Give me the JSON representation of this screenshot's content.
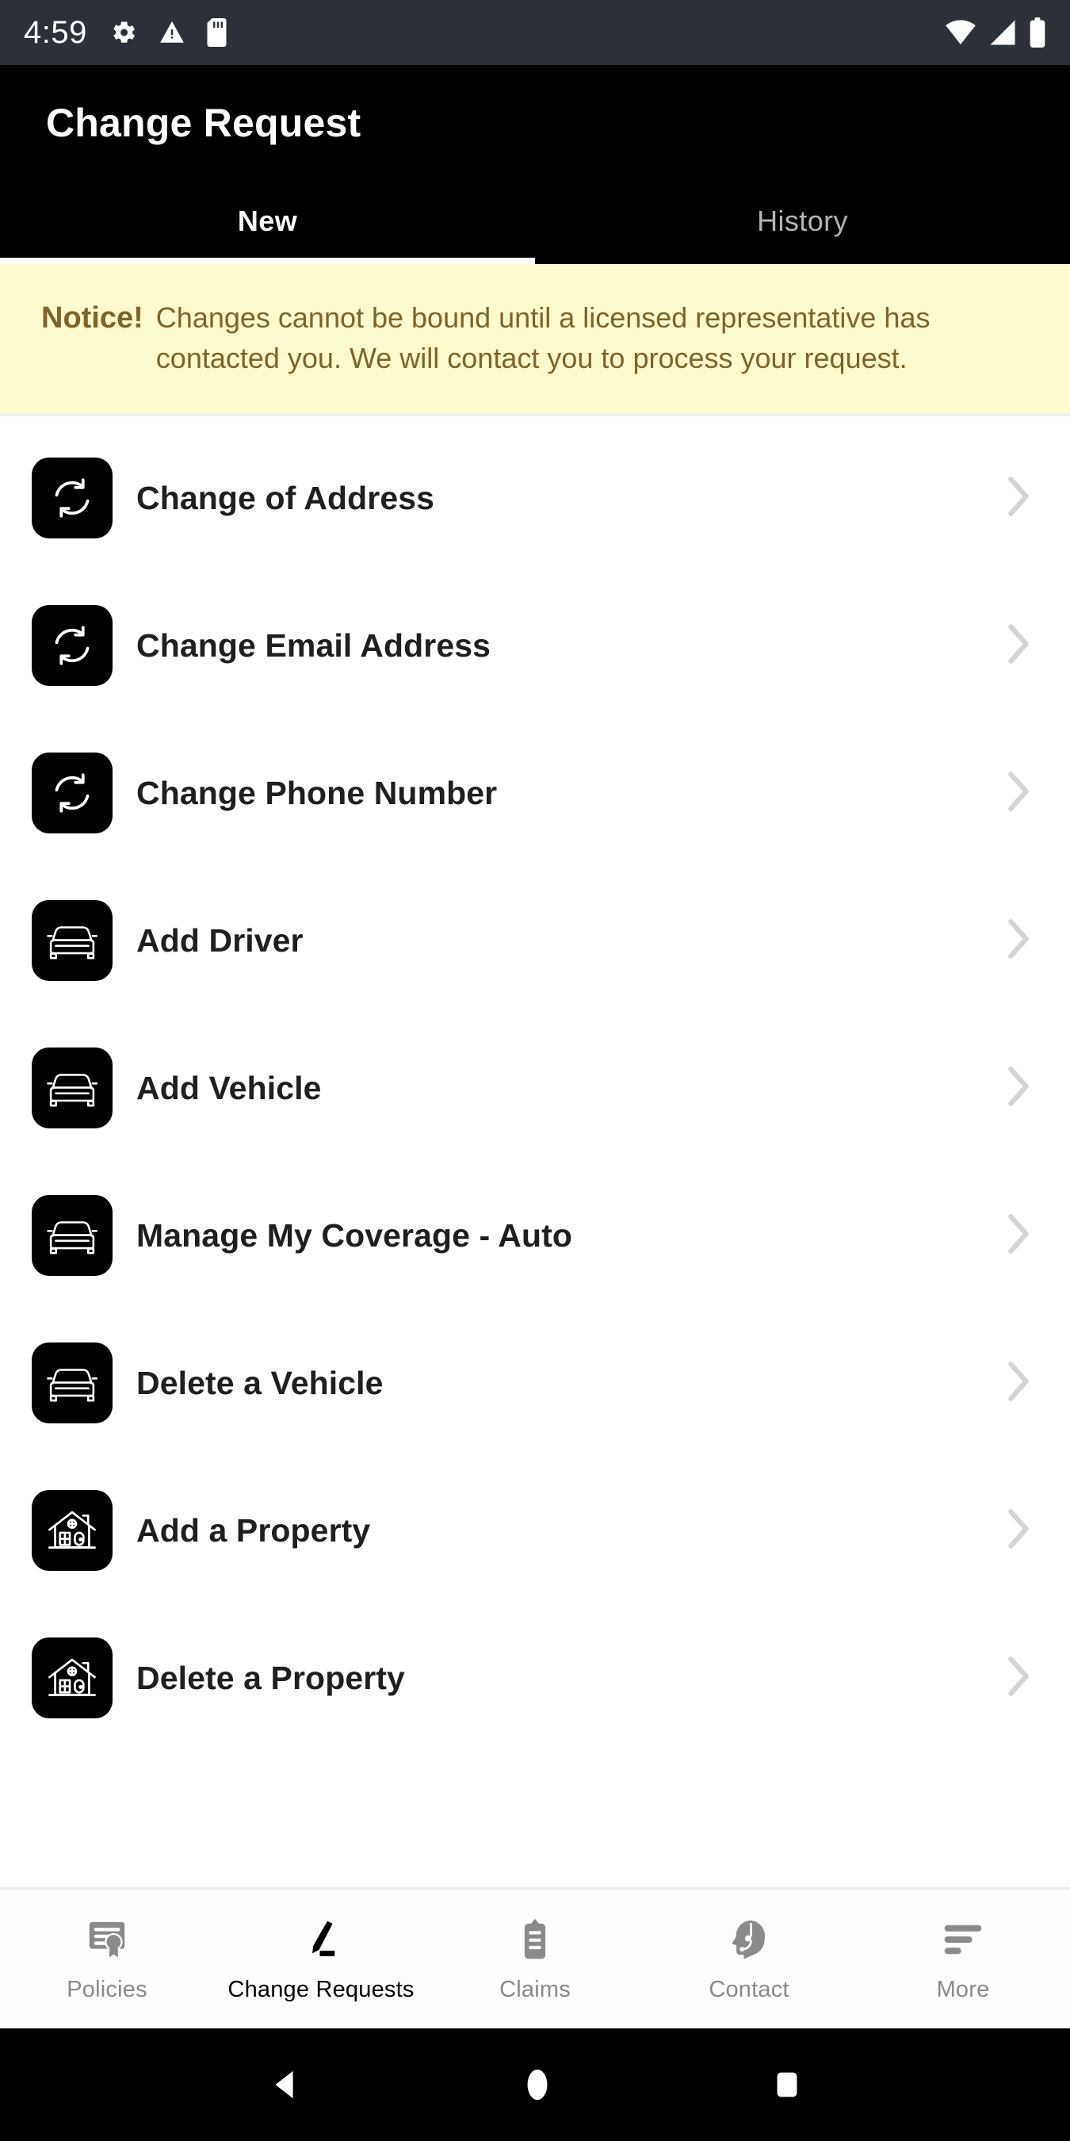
{
  "status_bar": {
    "time": "4:59",
    "left_icons": [
      "gear-icon",
      "warning-triangle-icon",
      "sd-card-icon"
    ],
    "right_icons": [
      "wifi-icon",
      "cellular-signal-icon",
      "battery-icon"
    ],
    "background_color": "#2c3038"
  },
  "app_bar": {
    "title": "Change Request",
    "background_color": "#000000"
  },
  "tabs": [
    {
      "label": "New",
      "active": true
    },
    {
      "label": "History",
      "active": false
    }
  ],
  "notice": {
    "label": "Notice!",
    "text": "Changes cannot be bound until a licensed representative has contacted you. We will contact you to process your request.",
    "background_color": "#fbfacc",
    "text_color": "#7d6428"
  },
  "list": {
    "items": [
      {
        "label": "Change of Address",
        "icon": "refresh-icon"
      },
      {
        "label": "Change Email Address",
        "icon": "refresh-icon"
      },
      {
        "label": "Change Phone Number",
        "icon": "refresh-icon"
      },
      {
        "label": "Add Driver",
        "icon": "car-icon"
      },
      {
        "label": "Add Vehicle",
        "icon": "car-icon"
      },
      {
        "label": "Manage My Coverage - Auto",
        "icon": "car-icon"
      },
      {
        "label": "Delete a Vehicle",
        "icon": "car-icon"
      },
      {
        "label": "Add a Property",
        "icon": "house-icon"
      },
      {
        "label": "Delete a Property",
        "icon": "house-icon"
      }
    ],
    "chevron_icon": "chevron-right-icon",
    "chevron_color": "#d4d4d4"
  },
  "bottom_nav": {
    "items": [
      {
        "label": "Policies",
        "icon": "certificate-icon",
        "active": false
      },
      {
        "label": "Change Requests",
        "icon": "pencil-icon",
        "active": true
      },
      {
        "label": "Claims",
        "icon": "clipboard-icon",
        "active": false
      },
      {
        "label": "Contact",
        "icon": "headset-icon",
        "active": false
      },
      {
        "label": "More",
        "icon": "menu-lines-icon",
        "active": false
      }
    ],
    "active_color": "#000000",
    "inactive_color": "#8a8a8a"
  },
  "android_nav": {
    "buttons": [
      "back-icon",
      "home-icon",
      "recents-icon"
    ],
    "background_color": "#000000"
  }
}
